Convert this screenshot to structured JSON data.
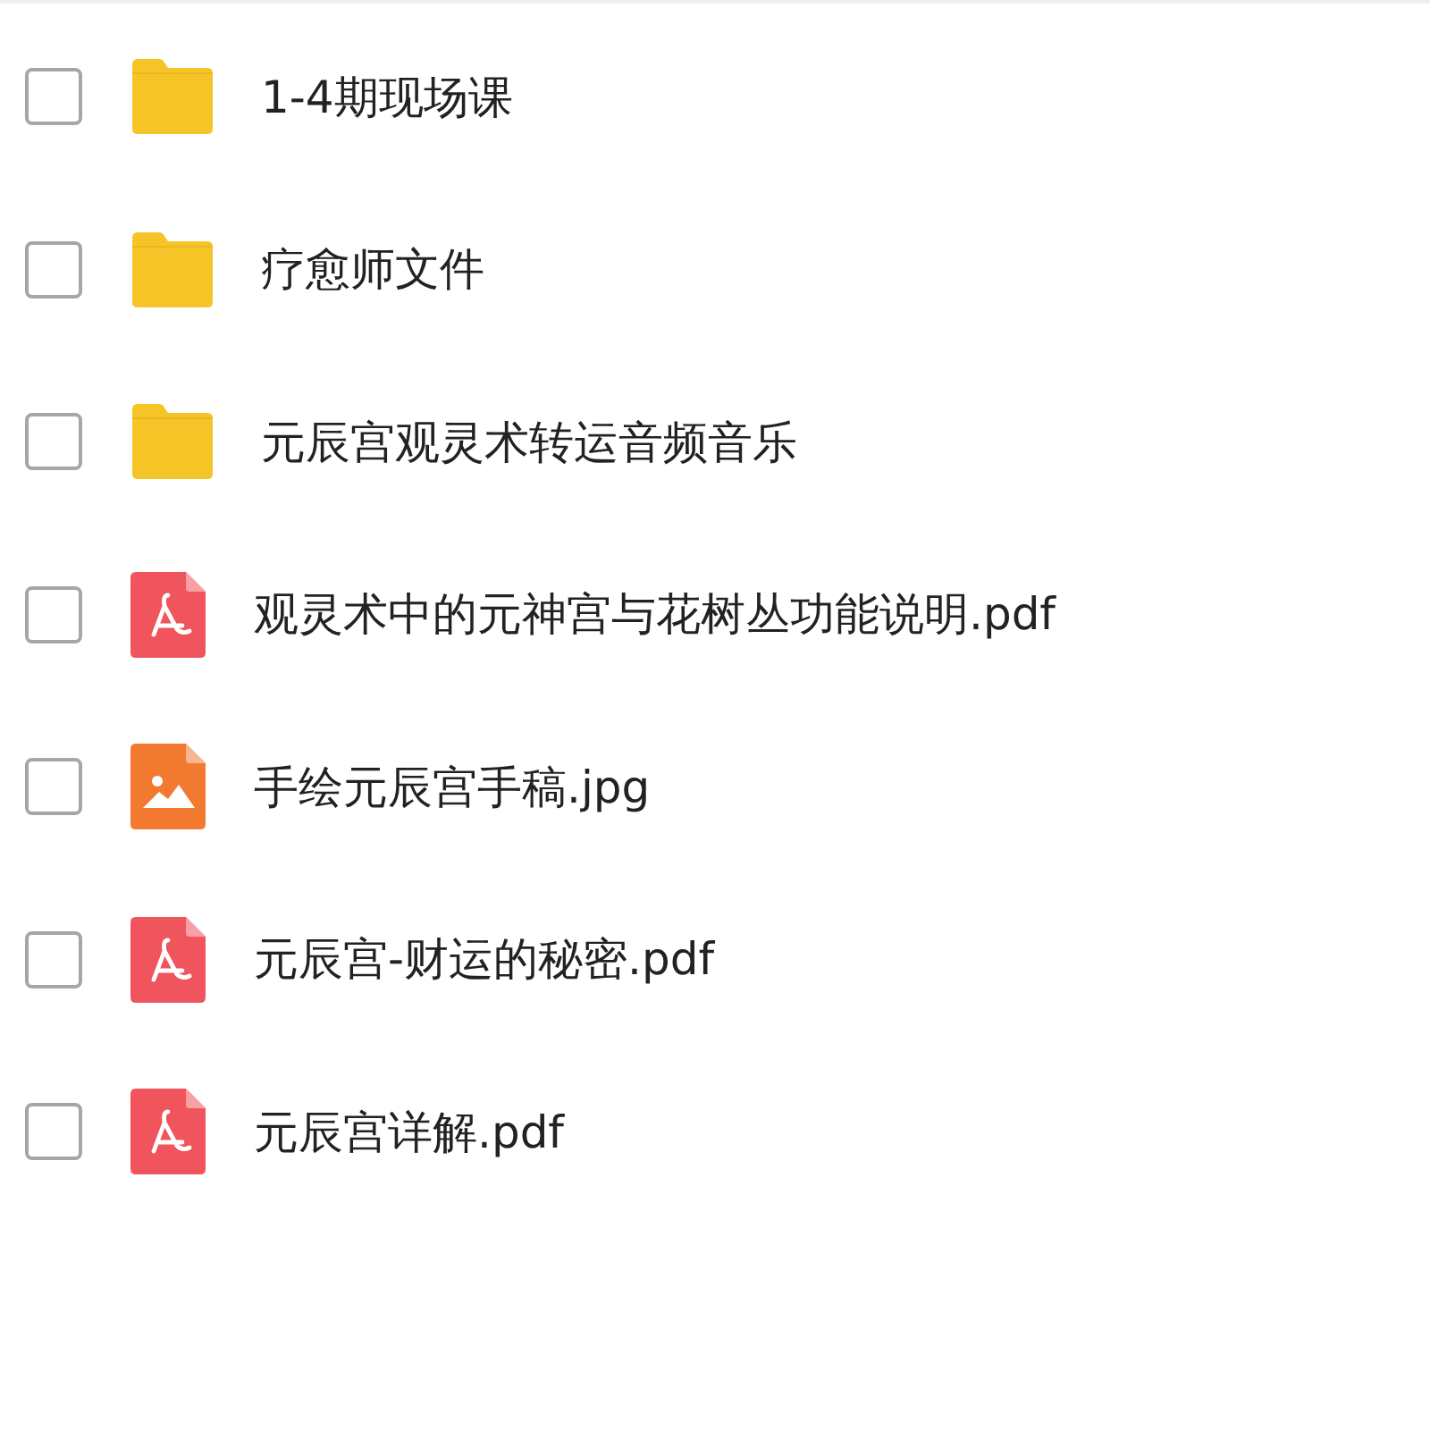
{
  "files": [
    {
      "kind": "folder",
      "name": "1-4期现场课",
      "checked": false
    },
    {
      "kind": "folder",
      "name": "疗愈师文件",
      "checked": false
    },
    {
      "kind": "folder",
      "name": "元辰宫观灵术转运音频音乐",
      "checked": false
    },
    {
      "kind": "pdf",
      "name": "观灵术中的元神宫与花树丛功能说明.pdf",
      "checked": false
    },
    {
      "kind": "image",
      "name": "手绘元辰宫手稿.jpg",
      "checked": false
    },
    {
      "kind": "pdf",
      "name": "元辰宫-财运的秘密.pdf",
      "checked": false
    },
    {
      "kind": "pdf",
      "name": "元辰宫详解.pdf",
      "checked": false
    }
  ]
}
